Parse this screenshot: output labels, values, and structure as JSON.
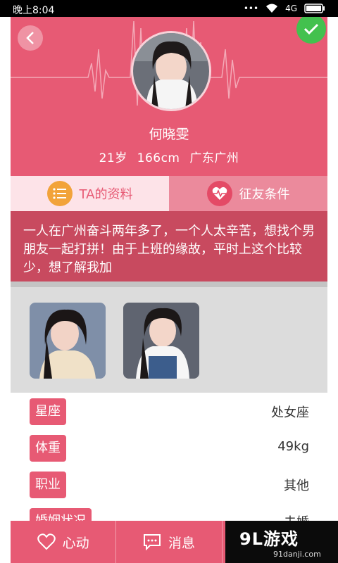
{
  "status_bar": {
    "time": "晚上8:04",
    "signal": "•••",
    "network": "4G"
  },
  "profile": {
    "name": "何晓雯",
    "age": "21岁",
    "height": "166cm",
    "location": "广东广州"
  },
  "tabs": [
    {
      "label": "TA的资料",
      "icon": "list-icon",
      "active": true
    },
    {
      "label": "征友条件",
      "icon": "heart-pulse-icon",
      "active": false
    }
  ],
  "bio": "一人在广州奋斗两年多了，一个人太辛苦，想找个男朋友一起打拼！由于上班的缘故，平时上这个比较少，想了解我加",
  "details": [
    {
      "label": "星座",
      "value": "处女座"
    },
    {
      "label": "体重",
      "value": "49kg"
    },
    {
      "label": "职业",
      "value": "其他"
    },
    {
      "label": "婚姻状况",
      "value": "未婚"
    }
  ],
  "bottom_bar": {
    "like_label": "心动",
    "message_label": "消息"
  },
  "watermark": {
    "brand": "9L游戏",
    "url": "91danji.com"
  },
  "colors": {
    "primary": "#e75a74",
    "bio_bg": "#c84a5f",
    "check_green": "#43c14e"
  }
}
